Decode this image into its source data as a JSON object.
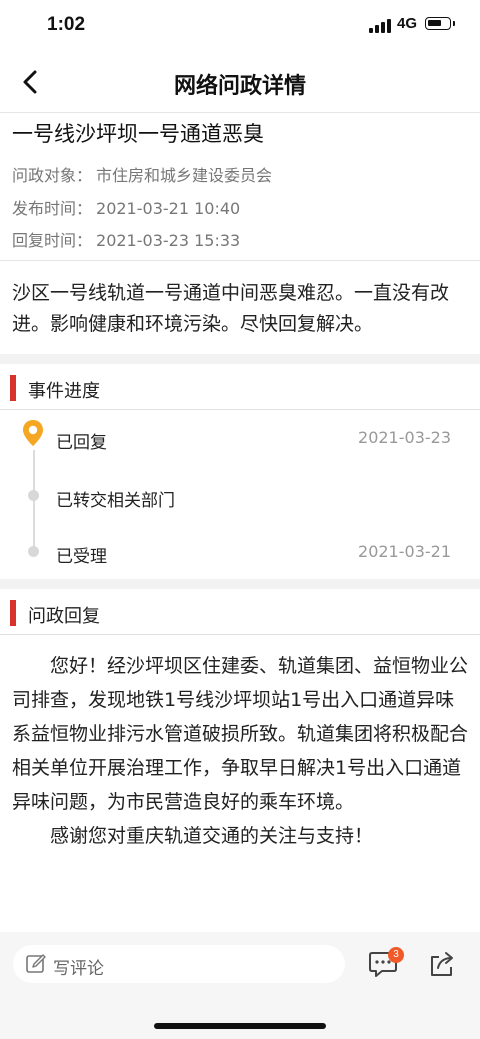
{
  "status_bar": {
    "time": "1:02",
    "network": "4G"
  },
  "nav": {
    "title": "网络问政详情"
  },
  "post": {
    "title": "一号线沙坪坝一号通道恶臭",
    "target_label": "问政对象：",
    "target_value": "市住房和城乡建设委员会",
    "publish_label": "发布时间：",
    "publish_value": "2021-03-21 10:40",
    "reply_label": "回复时间：",
    "reply_value": "2021-03-23 15:33",
    "description": "沙区一号线轨道一号通道中间恶臭难忍。一直没有改进。影响健康和环境污染。尽快回复解决。"
  },
  "progress": {
    "section_title": "事件进度",
    "items": [
      {
        "label": "已回复",
        "date": "2021-03-23"
      },
      {
        "label": "已转交相关部门",
        "date": ""
      },
      {
        "label": "已受理",
        "date": "2021-03-21"
      }
    ]
  },
  "reply_section": {
    "section_title": "问政回复",
    "paragraphs": [
      "您好！经沙坪坝区住建委、轨道集团、益恒物业公司排查，发现地铁1号线沙坪坝站1号出入口通道异味系益恒物业排污水管道破损所致。轨道集团将积极配合相关单位开展治理工作，争取早日解决1号出入口通道异味问题，为市民营造良好的乘车环境。",
      "感谢您对重庆轨道交通的关注与支持！"
    ]
  },
  "bottom_bar": {
    "comment_placeholder": "写评论",
    "comment_count": "3"
  },
  "colors": {
    "accent_red": "#d9312b",
    "pin_orange": "#f5a623",
    "badge_orange": "#f05a28"
  },
  "icons": [
    "back-arrow-icon",
    "location-pin-icon",
    "pencil-icon",
    "chat-bubble-icon",
    "share-icon"
  ]
}
